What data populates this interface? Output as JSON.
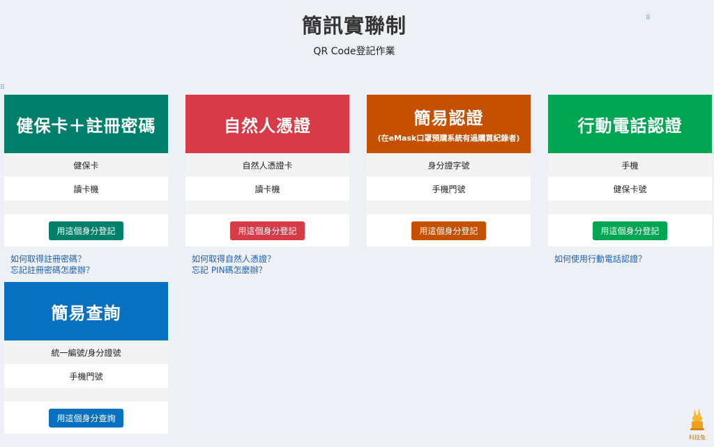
{
  "header": {
    "title": "簡訊實聯制",
    "subtitle": "QR Code登記作業"
  },
  "cards": [
    {
      "title": "健保卡＋註冊密碼",
      "note": "",
      "color": "#00806a",
      "rows": [
        "健保卡",
        "讀卡機"
      ],
      "button": "用這個身分登記",
      "links": [
        "如何取得註冊密碼？",
        "忘記註冊密碼怎麼辦？"
      ]
    },
    {
      "title": "自然人憑證",
      "note": "",
      "color": "#d63b47",
      "rows": [
        "自然人憑證卡",
        "讀卡機"
      ],
      "button": "用這個身分登記",
      "links": [
        "如何取得自然人憑證？",
        "忘記 PIN碼怎麼辦？"
      ]
    },
    {
      "title": "簡易認證",
      "note": "(在eMask口罩預購系統有過購買紀錄者)",
      "color": "#c45000",
      "rows": [
        "身分證字號",
        "手機門號"
      ],
      "button": "用這個身分登記",
      "links": []
    },
    {
      "title": "行動電話認證",
      "note": "",
      "color": "#00a651",
      "rows": [
        "手機",
        "健保卡號"
      ],
      "button": "用這個身分登記",
      "links": [
        "如何使用行動電話認證？"
      ]
    },
    {
      "title": "簡易查詢",
      "note": "",
      "color": "#0870c0",
      "rows": [
        "統一編號/身分證號",
        "手機門號"
      ],
      "button": "用這個身分查詢",
      "links": []
    }
  ],
  "logo": {
    "label": "科技兔",
    "icon": "rabbit-hat-icon",
    "color": "#f0a020"
  }
}
